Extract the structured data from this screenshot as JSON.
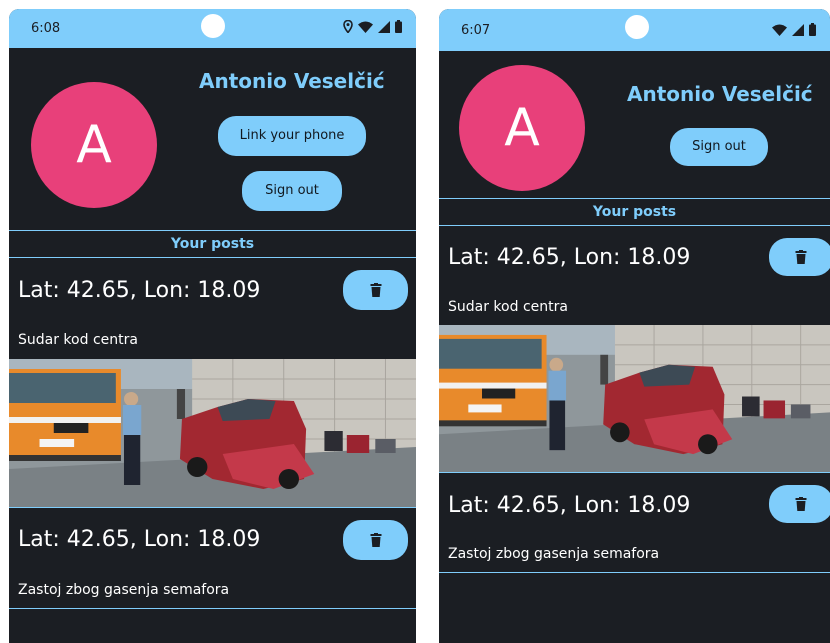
{
  "screens": [
    {
      "status": {
        "time": "6:08"
      },
      "profile": {
        "avatar_letter": "A",
        "name": "Antonio Veselčić"
      },
      "buttons": {
        "link_phone": "Link your phone",
        "sign_out": "Sign out"
      },
      "section_title": "Your posts",
      "posts": [
        {
          "coords": "Lat: 42.65, Lon: 18.09",
          "description": "Sudar kod centra",
          "has_photo": true
        },
        {
          "coords": "Lat: 42.65, Lon: 18.09",
          "description": "Zastoj zbog gasenja semafora",
          "has_photo": false
        }
      ]
    },
    {
      "status": {
        "time": "6:07"
      },
      "profile": {
        "avatar_letter": "A",
        "name": "Antonio Veselčić"
      },
      "buttons": {
        "sign_out": "Sign out"
      },
      "section_title": "Your posts",
      "posts": [
        {
          "coords": "Lat: 42.65, Lon: 18.09",
          "description": "Sudar kod centra",
          "has_photo": true
        },
        {
          "coords": "Lat: 42.65, Lon: 18.09",
          "description": "Zastoj zbog gasenja semafora",
          "has_photo": false
        }
      ]
    }
  ],
  "colors": {
    "accent": "#7fcdfb",
    "background": "#1b1e23",
    "avatar": "#e8407a"
  },
  "icons": [
    "location-icon",
    "wifi-icon",
    "signal-icon",
    "battery-icon",
    "trash-icon"
  ]
}
